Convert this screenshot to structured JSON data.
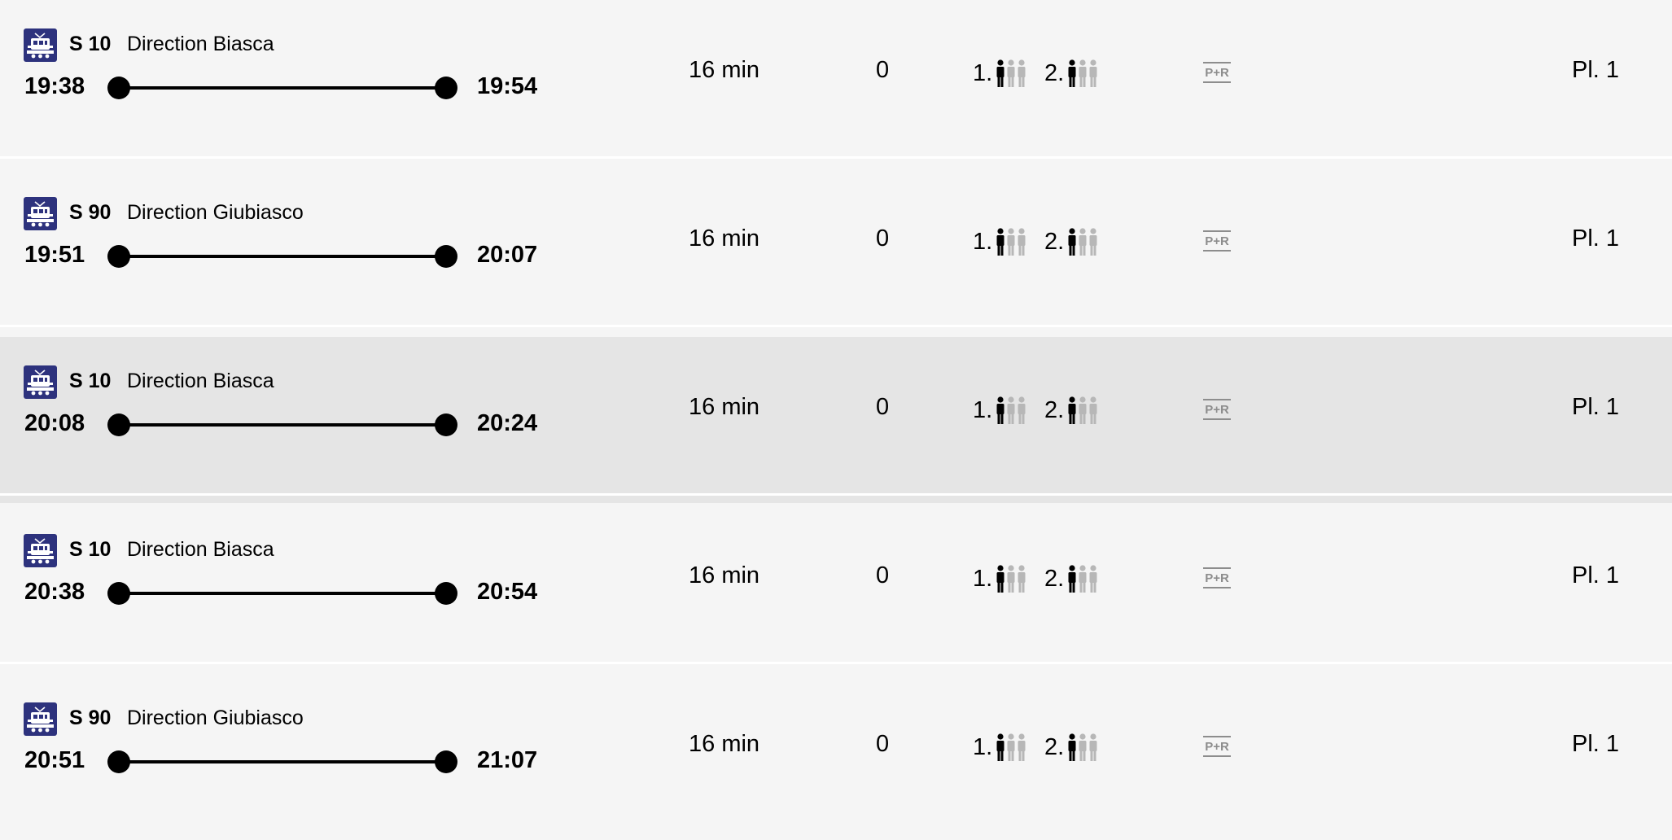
{
  "colors": {
    "row_background": "#f5f5f5",
    "row_selected_background": "#e5e5e5",
    "divider": "#ffffff",
    "train_icon_background": "#2d327d",
    "occupancy_active": "#000000",
    "occupancy_inactive": "#b7b7b7",
    "pr_icon": "#8d8d8d"
  },
  "icons": {
    "train": "train-icon",
    "occupancy": "person-icon",
    "park_and_ride": "park-and-ride-icon"
  },
  "connections": [
    {
      "line": "S 10",
      "direction": "Direction Biasca",
      "departure": "19:38",
      "arrival": "19:54",
      "duration": "16 min",
      "changes": "0",
      "class1_label": "1.",
      "class1_occupancy": 1,
      "class2_label": "2.",
      "class2_occupancy": 1,
      "pr_label": "P+R",
      "platform": "Pl. 1",
      "selected": false
    },
    {
      "line": "S 90",
      "direction": "Direction Giubiasco",
      "departure": "19:51",
      "arrival": "20:07",
      "duration": "16 min",
      "changes": "0",
      "class1_label": "1.",
      "class1_occupancy": 1,
      "class2_label": "2.",
      "class2_occupancy": 1,
      "pr_label": "P+R",
      "platform": "Pl. 1",
      "selected": false
    },
    {
      "line": "S 10",
      "direction": "Direction Biasca",
      "departure": "20:08",
      "arrival": "20:24",
      "duration": "16 min",
      "changes": "0",
      "class1_label": "1.",
      "class1_occupancy": 1,
      "class2_label": "2.",
      "class2_occupancy": 1,
      "pr_label": "P+R",
      "platform": "Pl. 1",
      "selected": true
    },
    {
      "line": "S 10",
      "direction": "Direction Biasca",
      "departure": "20:38",
      "arrival": "20:54",
      "duration": "16 min",
      "changes": "0",
      "class1_label": "1.",
      "class1_occupancy": 1,
      "class2_label": "2.",
      "class2_occupancy": 1,
      "pr_label": "P+R",
      "platform": "Pl. 1",
      "selected": false
    },
    {
      "line": "S 90",
      "direction": "Direction Giubiasco",
      "departure": "20:51",
      "arrival": "21:07",
      "duration": "16 min",
      "changes": "0",
      "class1_label": "1.",
      "class1_occupancy": 1,
      "class2_label": "2.",
      "class2_occupancy": 1,
      "pr_label": "P+R",
      "platform": "Pl. 1",
      "selected": false
    }
  ]
}
